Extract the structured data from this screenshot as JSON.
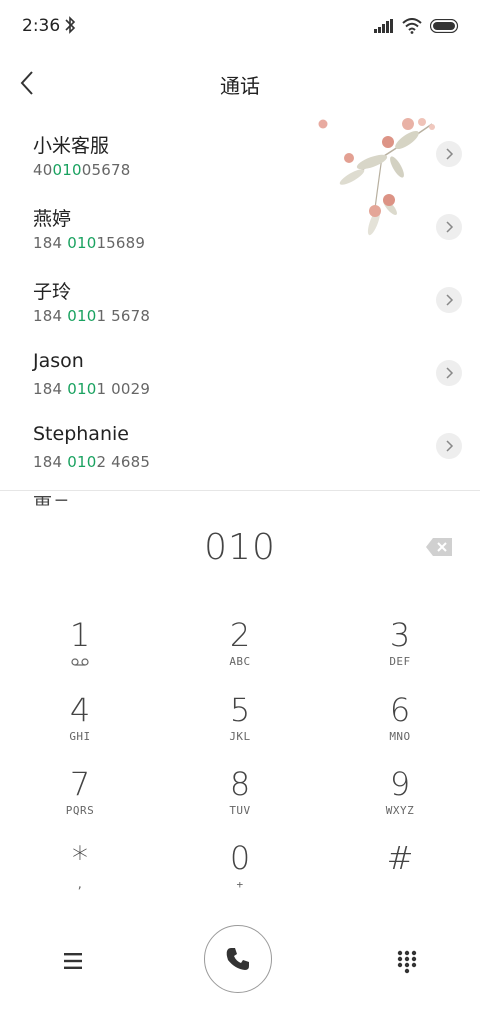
{
  "status_bar": {
    "time": "2:36",
    "icons": [
      "bluetooth-icon",
      "signal-icon",
      "wifi-icon",
      "battery-icon"
    ]
  },
  "header": {
    "title": "通话",
    "back_icon": "back-arrow-icon"
  },
  "contacts": [
    {
      "name": "小米客服",
      "number_parts": [
        "40",
        "010",
        "05678"
      ]
    },
    {
      "name": "燕婷",
      "number_parts": [
        "184 ",
        "010",
        "15689"
      ]
    },
    {
      "name": "子玲",
      "number_parts": [
        "184 ",
        "010",
        "1 5678"
      ]
    },
    {
      "name": "Jason",
      "number_parts": [
        "184 ",
        "010",
        "1 0029"
      ]
    },
    {
      "name": "Stephanie",
      "number_parts": [
        "184 ",
        "010",
        "2 4685"
      ]
    }
  ],
  "next_contact_peek": "黄三",
  "dial": {
    "number": "010",
    "backspace_icon": "backspace-icon"
  },
  "keypad": [
    {
      "digit": "1",
      "sub": "voicemail-icon"
    },
    {
      "digit": "2",
      "sub": "ABC"
    },
    {
      "digit": "3",
      "sub": "DEF"
    },
    {
      "digit": "4",
      "sub": "GHI"
    },
    {
      "digit": "5",
      "sub": "JKL"
    },
    {
      "digit": "6",
      "sub": "MNO"
    },
    {
      "digit": "7",
      "sub": "PQRS"
    },
    {
      "digit": "8",
      "sub": "TUV"
    },
    {
      "digit": "9",
      "sub": "WXYZ"
    },
    {
      "digit": "*",
      "sub": ","
    },
    {
      "digit": "0",
      "sub": "+"
    },
    {
      "digit": "#",
      "sub": ""
    }
  ],
  "bottom_bar": {
    "menu_icon": "menu-icon",
    "call_icon": "phone-icon",
    "keypad_icon": "dialpad-icon"
  },
  "colors": {
    "highlight": "#1aa260",
    "text": "#222222",
    "secondary_text": "#666666"
  }
}
